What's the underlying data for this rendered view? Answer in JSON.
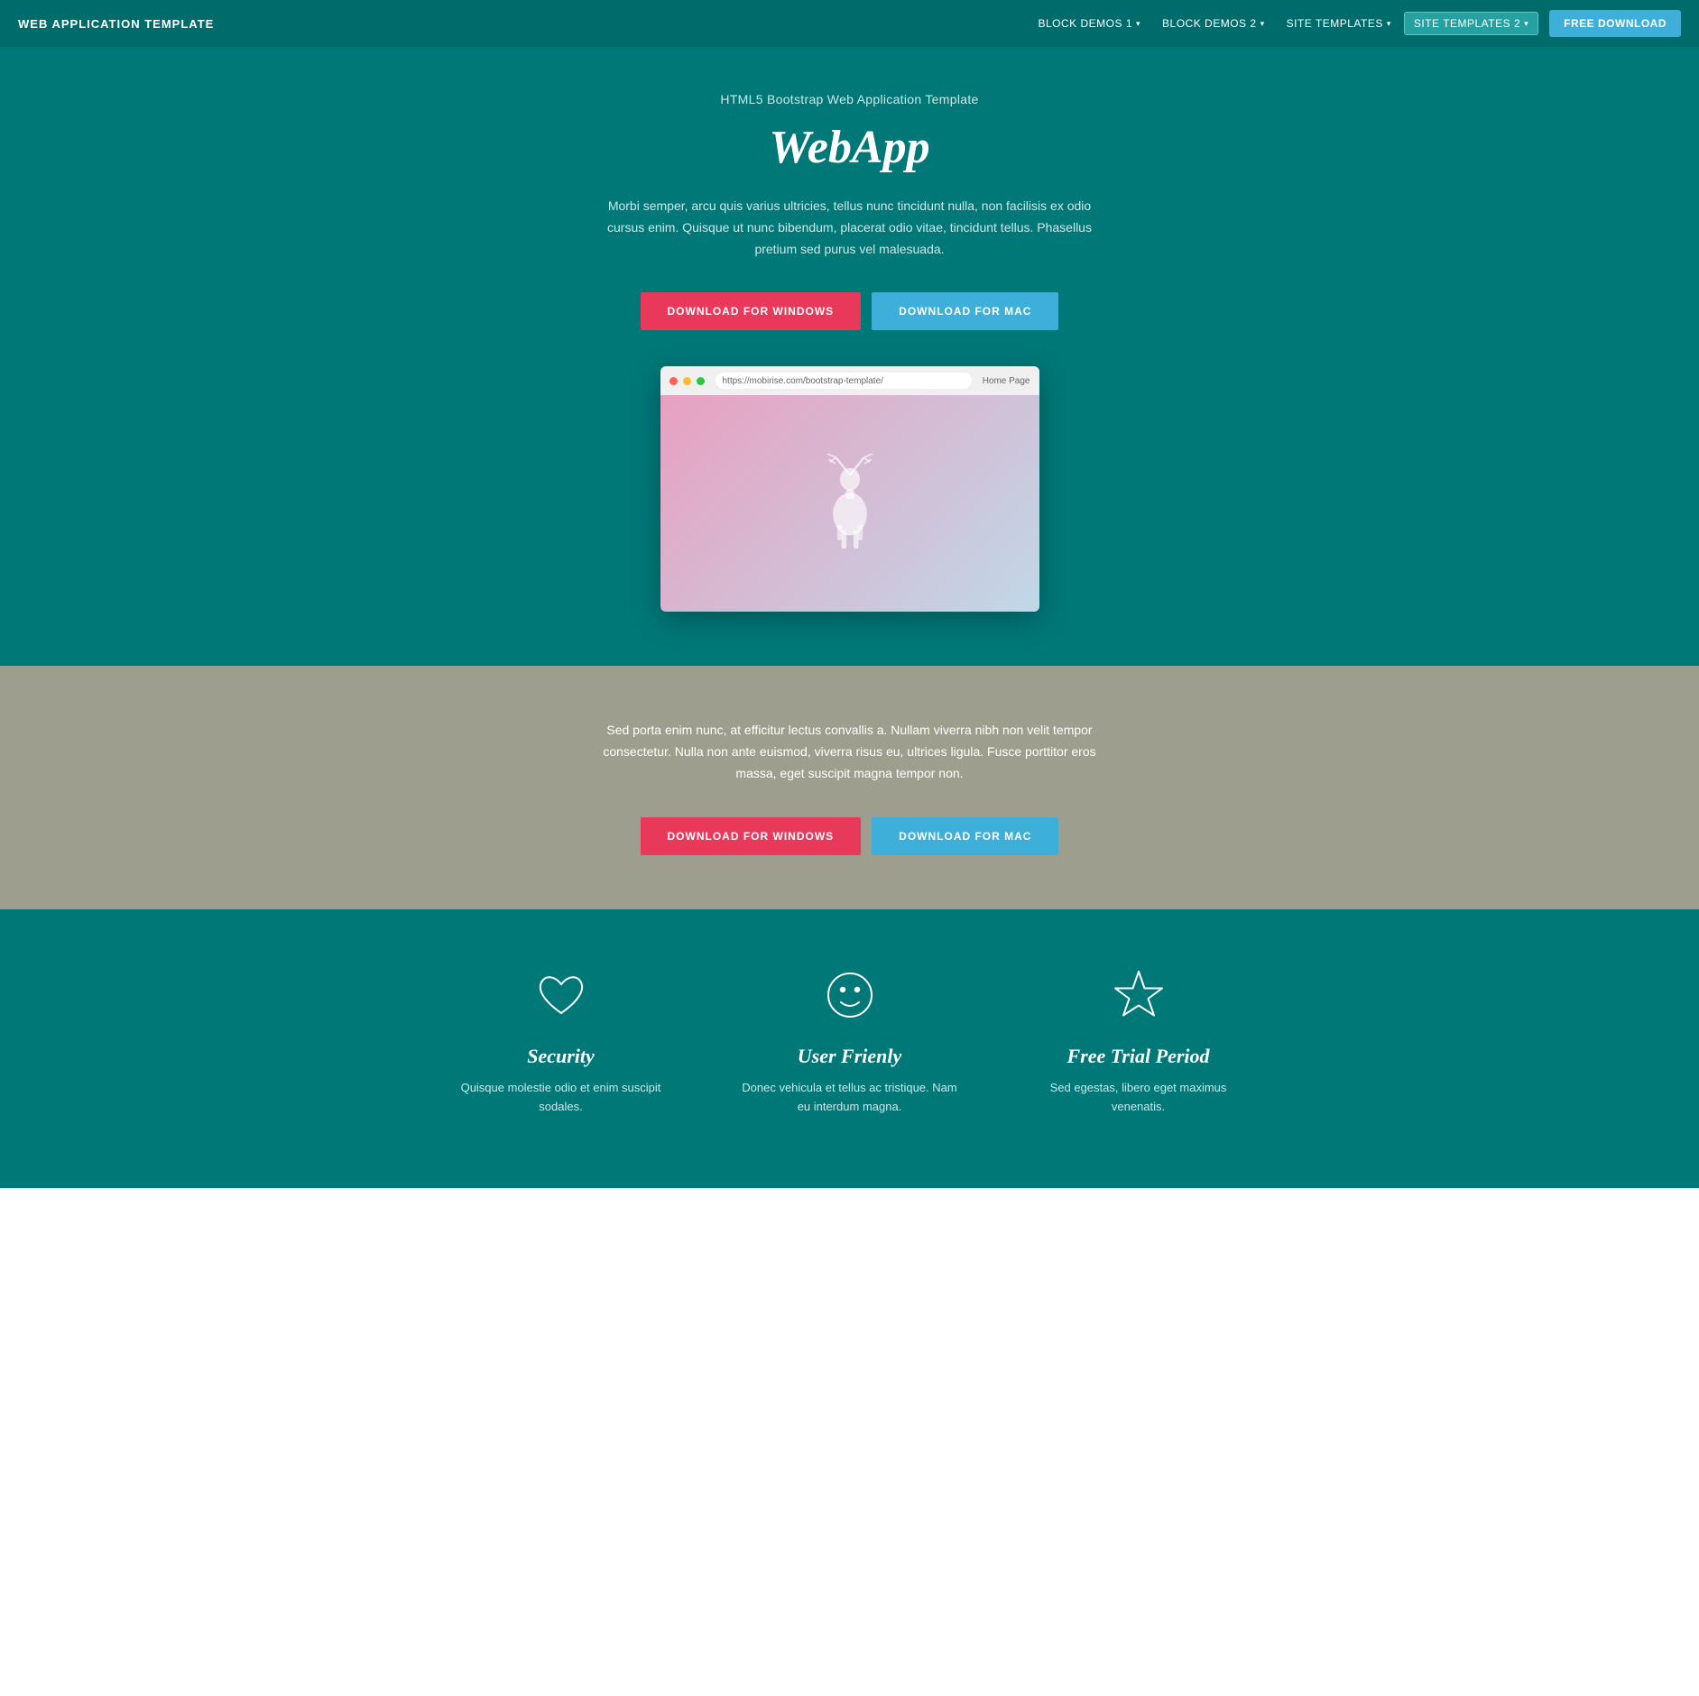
{
  "navbar": {
    "brand": "WEB APPLICATION TEMPLATE",
    "links": [
      {
        "label": "BLOCK DEMOS 1",
        "hasDropdown": true
      },
      {
        "label": "BLOCK DEMOS 2",
        "hasDropdown": true
      },
      {
        "label": "SITE TEMPLATES",
        "hasDropdown": true
      }
    ],
    "activeLink": "SITE TEMPLATES 2",
    "freeDownload": "FREE DOWNLOAD"
  },
  "hero": {
    "subtitle": "HTML5 Bootstrap Web Application Template",
    "title": "WebApp",
    "description": "Morbi semper, arcu quis varius ultricies, tellus nunc tincidunt nulla, non facilisis ex odio cursus enim. Quisque ut nunc bibendum, placerat odio vitae, tincidunt tellus. Phasellus pretium sed purus vel malesuada.",
    "btnWindows": "DOWNLOAD FOR WINDOWS",
    "btnMac": "DOWNLOAD FOR MAC",
    "browserUrl": "https://mobirise.com/bootstrap-template/",
    "browserHome": "Home Page"
  },
  "greySection": {
    "description": "Sed porta enim nunc, at efficitur lectus convallis a. Nullam viverra nibh non velit tempor consectetur. Nulla non ante euismod, viverra risus eu, ultrices ligula. Fusce porttitor eros massa, eget suscipit magna tempor non.",
    "btnWindows": "DOWNLOAD FOR WINDOWS",
    "btnMac": "DOWNLOAD FOR MAC"
  },
  "features": [
    {
      "icon": "heart",
      "title": "Security",
      "description": "Quisque molestie odio et enim suscipit sodales."
    },
    {
      "icon": "smiley",
      "title": "User Frienly",
      "description": "Donec vehicula et tellus ac tristique. Nam eu interdum magna."
    },
    {
      "icon": "star",
      "title": "Free Trial Period",
      "description": "Sed egestas, libero eget maximus venenatis."
    }
  ]
}
